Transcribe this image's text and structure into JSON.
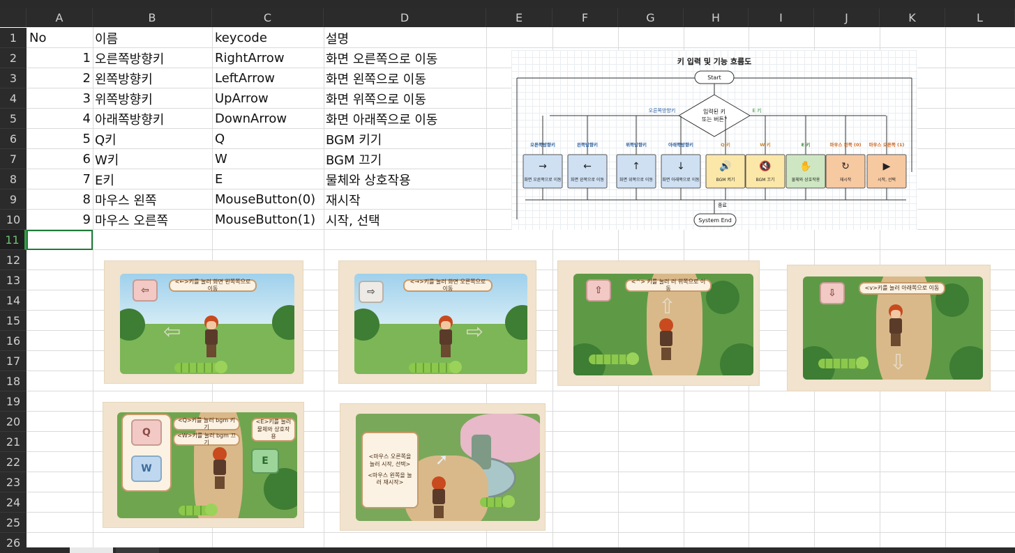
{
  "columns": [
    "A",
    "B",
    "C",
    "D",
    "E",
    "F",
    "G",
    "H",
    "I",
    "J",
    "K",
    "L"
  ],
  "rows": [
    "1",
    "2",
    "3",
    "4",
    "5",
    "6",
    "7",
    "8",
    "9",
    "10",
    "11",
    "12",
    "13",
    "14",
    "15",
    "16",
    "17",
    "18",
    "19",
    "20",
    "21",
    "22",
    "23",
    "24",
    "25",
    "26"
  ],
  "selected_row": "11",
  "table": {
    "headers": [
      "No",
      "이름",
      "keycode",
      "설명"
    ],
    "rows": [
      {
        "no": "1",
        "name": "오른쪽방향키",
        "keycode": "RightArrow",
        "desc": "화면 오른쪽으로 이동"
      },
      {
        "no": "2",
        "name": "왼쪽방향키",
        "keycode": "LeftArrow",
        "desc": "화면 왼쪽으로 이동"
      },
      {
        "no": "3",
        "name": "위쪽방향키",
        "keycode": "UpArrow",
        "desc": "화면 위쪽으로 이동"
      },
      {
        "no": "4",
        "name": "아래쪽방향키",
        "keycode": "DownArrow",
        "desc": "화면 아래쪽으로 이동"
      },
      {
        "no": "5",
        "name": "Q키",
        "keycode": "Q",
        "desc": "BGM 키기"
      },
      {
        "no": "6",
        "name": "W키",
        "keycode": "W",
        "desc": "BGM 끄기"
      },
      {
        "no": "7",
        "name": "E키",
        "keycode": "E",
        "desc": "물체와 상호작용"
      },
      {
        "no": "8",
        "name": "마우스 왼쪽",
        "keycode": "MouseButton(0)",
        "desc": "재시작"
      },
      {
        "no": "9",
        "name": "마우스 오른쪽",
        "keycode": "MouseButton(1)",
        "desc": "시작, 선택"
      }
    ]
  },
  "flowchart": {
    "title": "키 입력 및 기능 흐름도",
    "start": "Start",
    "decision": "입력된 키 또는 버튼?",
    "decision_left": "오른쪽방향키",
    "decision_right": "E 키",
    "end_label": "종료",
    "end": "System End",
    "branches": [
      {
        "label": "오른쪽방향키",
        "box": "화면 오른쪽으로 이동",
        "icon": "→",
        "color": "#cfe0f3",
        "label_color": "#2a5e9c"
      },
      {
        "label": "왼쪽방향키",
        "box": "화면 왼쪽으로 이동",
        "icon": "←",
        "color": "#cfe0f3",
        "label_color": "#2a5e9c"
      },
      {
        "label": "위쪽방향키",
        "box": "화면 위쪽으로 이동",
        "icon": "↑",
        "color": "#cfe0f3",
        "label_color": "#2a5e9c"
      },
      {
        "label": "아래쪽방향키",
        "box": "화면 아래쪽으로 이동",
        "icon": "↓",
        "color": "#cfe0f3",
        "label_color": "#2a5e9c"
      },
      {
        "label": "Q 키",
        "box": "BGM 켜기",
        "icon": "🔊",
        "color": "#fbe7a8",
        "label_color": "#c9822b"
      },
      {
        "label": "W 키",
        "box": "BGM 끄기",
        "icon": "🔇",
        "color": "#fbe7a8",
        "label_color": "#c9822b"
      },
      {
        "label": "E 키",
        "box": "물체와 상호작용",
        "icon": "✋",
        "color": "#cfe6c3",
        "label_color": "#3c8a3a"
      },
      {
        "label": "마우스 왼쪽 (0)",
        "box": "재시작",
        "icon": "↻",
        "color": "#f7c9a1",
        "label_color": "#c9651e"
      },
      {
        "label": "마우스 오른쪽 (1)",
        "box": "시작, 선택",
        "icon": "▶",
        "color": "#f7c9a1",
        "label_color": "#c9651e"
      }
    ]
  },
  "images": {
    "left": {
      "caption": "<←>키를 눌러 화면 왼쪽쪽으로 이동",
      "key": "⇦"
    },
    "right": {
      "caption": "<→>키를 눌러 화면 오른쪽으로 이동",
      "key": "⇨"
    },
    "up": {
      "caption": "<^> 키를 눌러 러 위쪽으로 이동",
      "key": "⇧"
    },
    "down": {
      "caption": "<v>키를 눌러 아래쪽으로 이동",
      "key": "⇩"
    },
    "qwe": {
      "q_caption": "<Q>키를 눌러 bgm 키기",
      "w_caption": "<W>키를 눌러 bgm 끄기",
      "e_caption": "<E>키를 눌러 물체와 상호작용",
      "q": "Q",
      "w": "W",
      "e": "E"
    },
    "mouse": {
      "right_caption": "<마우스 오른쪽을 눌러 시작, 선택>",
      "left_caption": "<마우스 왼쪽을 눌러 재시작>"
    }
  }
}
